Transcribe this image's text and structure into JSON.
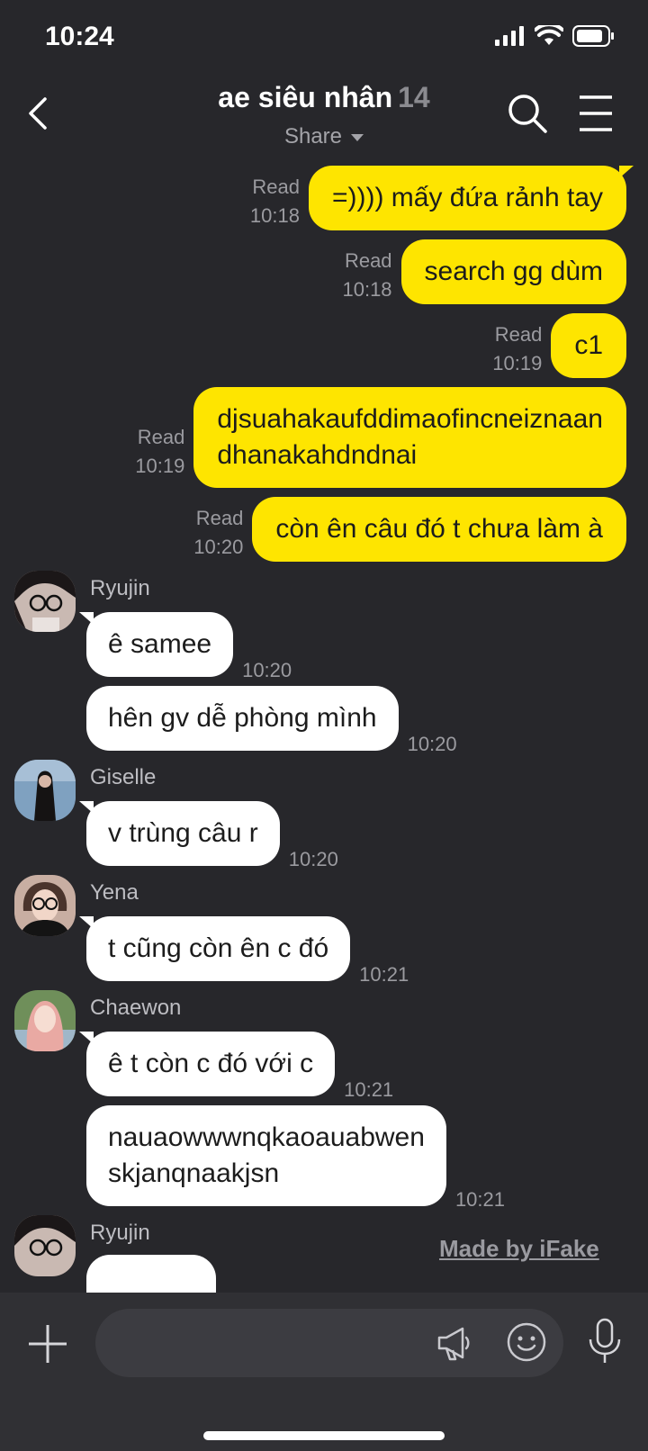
{
  "status_bar": {
    "time": "10:24"
  },
  "header": {
    "title": "ae siêu nhân",
    "member_count": "14",
    "share_label": "Share"
  },
  "messages_out": [
    {
      "text": "=)))) mấy đứa rảnh tay",
      "read": "Read",
      "time": "10:18"
    },
    {
      "text": "search gg dùm",
      "read": "Read",
      "time": "10:18"
    },
    {
      "text": "c1",
      "read": "Read",
      "time": "10:19"
    },
    {
      "line1": "djsuahakaufddimaofincneiznaan",
      "line2": "dhanakahdndnai",
      "read": "Read",
      "time": "10:19"
    },
    {
      "text": "còn ên câu đó t chưa làm à",
      "read": "Read",
      "time": "10:20"
    }
  ],
  "messages_in": [
    {
      "sender": "Ryujin",
      "text": "ê samee",
      "time": "10:20"
    },
    {
      "text": "hên gv dễ phòng mình",
      "time": "10:20"
    },
    {
      "sender": "Giselle",
      "text": "v trùng câu r",
      "time": "10:20"
    },
    {
      "sender": "Yena",
      "text": "t cũng còn ên c đó",
      "time": "10:21"
    },
    {
      "sender": "Chaewon",
      "text": "ê t còn c đó với c",
      "time": "10:21"
    },
    {
      "line1": "nauaowwwnqkaoauabwen",
      "line2": "skjanqnaakjsn",
      "time": "10:21"
    },
    {
      "sender": "Ryujin"
    }
  ],
  "watermark": "Made by iFake",
  "composer": {
    "placeholder": ""
  },
  "icons": [
    "back-icon",
    "search-icon",
    "menu-icon",
    "plus-icon",
    "megaphone-icon",
    "emoji-icon",
    "microphone-icon",
    "signal-icon",
    "wifi-icon",
    "battery-icon"
  ],
  "colors": {
    "background": "#27272b",
    "outgoing_bubble": "#fee500",
    "incoming_bubble": "#ffffff",
    "meta_text": "#9b9ba0"
  }
}
